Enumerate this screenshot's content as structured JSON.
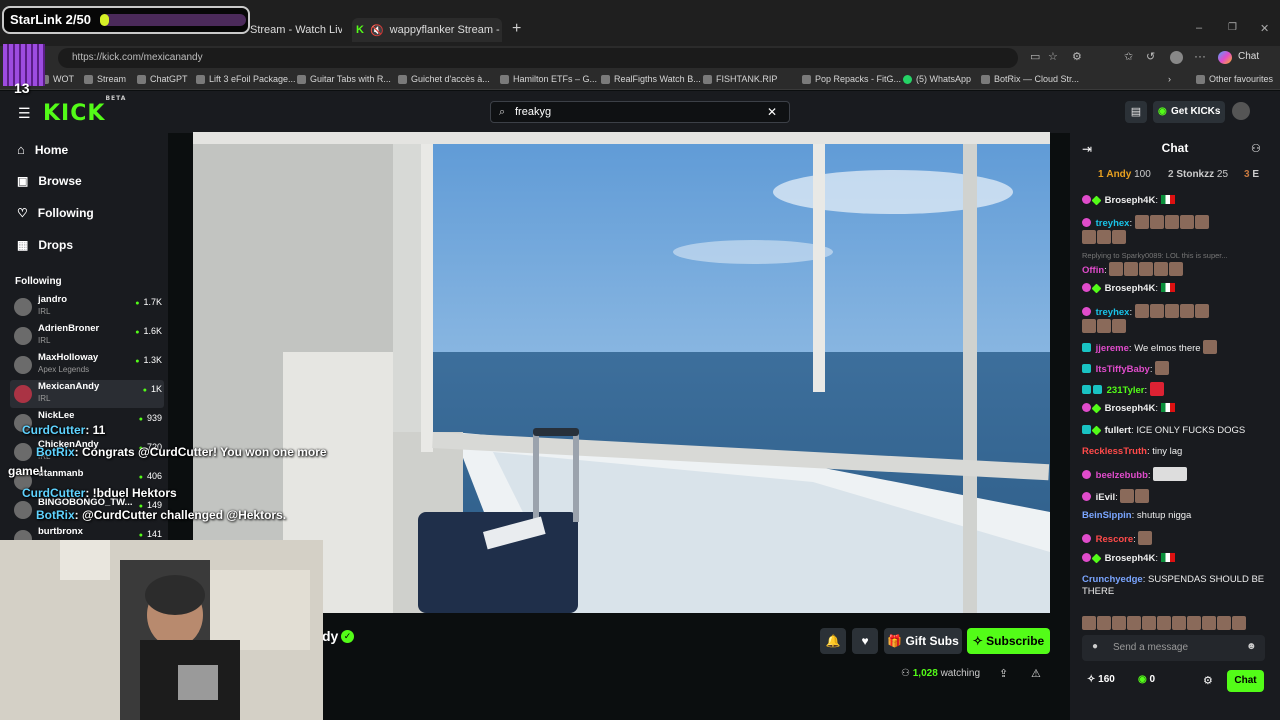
{
  "browser": {
    "tabs": [
      {
        "title": "Stream - Watch Live or"
      },
      {
        "title": "wappyflanker Stream - Watch"
      }
    ],
    "url": "https://kick.com/mexicanandy",
    "copilot_label": "Chat",
    "bookmarks": [
      "WOT",
      "Stream",
      "ChatGPT",
      "Lift 3 eFoil Package...",
      "Guitar Tabs with R...",
      "Guichet d'accès à...",
      "Hamilton ETFs – G...",
      "RealFigths Watch B...",
      "FISHTANK.RIP",
      "Pop Repacks - FitG...",
      "(5) WhatsApp",
      "BotRix — Cloud Str..."
    ],
    "other_favourites": "Other favourites"
  },
  "kick": {
    "logo": "KICK",
    "logo_sup": "BETA",
    "search_value": "freakyg",
    "get_kicks": "Get KICKs"
  },
  "sidebar": {
    "nav": [
      "Home",
      "Browse",
      "Following",
      "Drops"
    ],
    "following_title": "Following",
    "channels": [
      {
        "name": "jandro",
        "category": "IRL",
        "viewers": "1.7K"
      },
      {
        "name": "AdrienBroner",
        "category": "IRL",
        "viewers": "1.6K"
      },
      {
        "name": "MaxHolloway",
        "category": "Apex Legends",
        "viewers": "1.3K"
      },
      {
        "name": "MexicanAndy",
        "category": "IRL",
        "viewers": "1K"
      },
      {
        "name": "NickLee",
        "category": "",
        "viewers": "939"
      },
      {
        "name": "ChickenAndy",
        "category": "IRL",
        "viewers": "720"
      },
      {
        "name": "dtanmanb",
        "category": "",
        "viewers": "406"
      },
      {
        "name": "BINGOBONGO_TW...",
        "category": "",
        "viewers": "149"
      },
      {
        "name": "burtbronx",
        "category": "",
        "viewers": "141"
      }
    ]
  },
  "overlay": {
    "starlink": "StarLink 2/50",
    "starlink_progress": 0.04,
    "lines": [
      {
        "user": "CurdCutter",
        "text": ": 11"
      },
      {
        "user": "BotRix",
        "text": ": Congrats @CurdCutter! You won one more"
      },
      {
        "user": "",
        "text": "game!"
      },
      {
        "user": "CurdCutter",
        "text": ": !bduel Hektors"
      },
      {
        "user": "BotRix",
        "text": ": @CurdCutter challenged @Hektors."
      }
    ]
  },
  "stream": {
    "name_fragment": "dy",
    "gift_subs": "Gift Subs",
    "subscribe": "Subscribe",
    "watching_count": "1,028",
    "watching_label": "watching"
  },
  "chat": {
    "title": "Chat",
    "leaderboard": [
      {
        "rank": "1",
        "name": "Andy",
        "points": "100"
      },
      {
        "rank": "2",
        "name": "Stonkzz",
        "points": "25"
      },
      {
        "rank": "3",
        "name": "E",
        "points": ""
      }
    ],
    "reply_note": "Replying to Sparky0089: LOL this is super...",
    "messages": [
      {
        "user": "Broseph4K",
        "color": "#ffffff",
        "text": ""
      },
      {
        "user": "treyhex",
        "color": "#19c3e8",
        "text": ""
      },
      {
        "user": "Offin",
        "color": "#e04ccb",
        "text": ""
      },
      {
        "user": "Broseph4K",
        "color": "#ffffff",
        "text": ""
      },
      {
        "user": "treyhex",
        "color": "#19c3e8",
        "text": ""
      },
      {
        "user": "jjereme",
        "color": "#e04ccb",
        "text": "We elmos there"
      },
      {
        "user": "ItsTiffyBaby",
        "color": "#e04ccb",
        "text": ""
      },
      {
        "user": "231Tyler",
        "color": "#53fc18",
        "text": ""
      },
      {
        "user": "Broseph4K",
        "color": "#ffffff",
        "text": ""
      },
      {
        "user": "fullert",
        "color": "#ffffff",
        "text": "ICE ONLY FUCKS DOGS"
      },
      {
        "user": "RecklessTruth",
        "color": "#ff4a4a",
        "text": "tiny lag"
      },
      {
        "user": "beelzebubb",
        "color": "#e04ccb",
        "text": ""
      },
      {
        "user": "iEvil",
        "color": "#ffffff",
        "text": ""
      },
      {
        "user": "BeinSippin",
        "color": "#7aa5ff",
        "text": "shutup nigga"
      },
      {
        "user": "Rescore",
        "color": "#ff4a4a",
        "text": ""
      },
      {
        "user": "Broseph4K",
        "color": "#ffffff",
        "text": ""
      },
      {
        "user": "Crunchyedge",
        "color": "#7aa5ff",
        "text": "SUSPENDAS SHOULD BE THERE"
      }
    ],
    "input_placeholder": "Send a message",
    "points": "160",
    "kicks": "0",
    "send_label": "Chat"
  }
}
